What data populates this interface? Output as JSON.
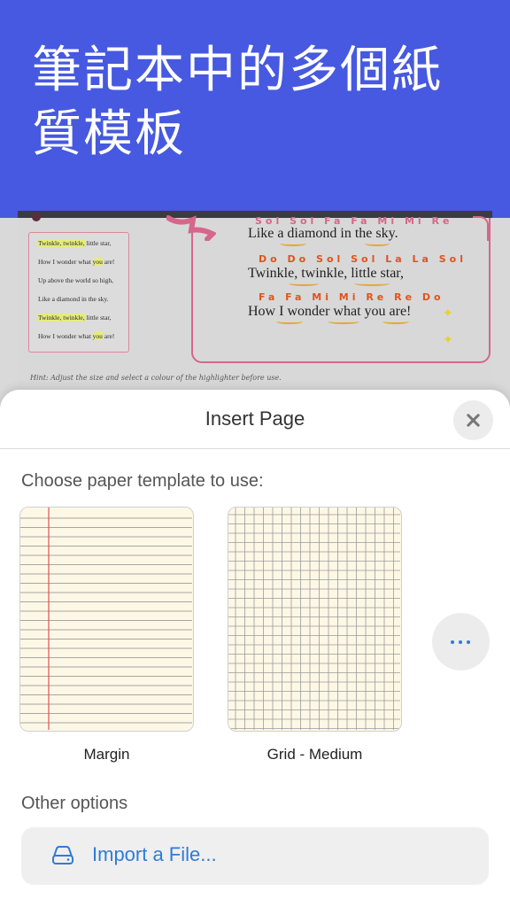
{
  "banner": {
    "title": "筆記本中的多個紙質模板"
  },
  "background_page": {
    "card_lines": [
      {
        "pre": "",
        "hl": "Twinkle, twinkle,",
        "post": " little star,"
      },
      {
        "pre": "How I wonder what ",
        "hl": "you",
        "post": " are!"
      },
      {
        "pre": "Up above the world so high,",
        "hl": "",
        "post": ""
      },
      {
        "pre": "Like a diamond in the sky.",
        "hl": "",
        "post": ""
      },
      {
        "pre": "",
        "hl": "Twinkle, twinkle,",
        "post": " little star,"
      },
      {
        "pre": "How I wonder what ",
        "hl": "you",
        "post": " are!"
      }
    ],
    "notes_top": "Sol Sol Fa Fa Mi Mi Re",
    "lyric_1": "Like a diamond in the sky.",
    "notes_2": "Do  Do  Sol Sol La La Sol",
    "lyric_2": "Twinkle, twinkle, little star,",
    "notes_3": "Fa Fa Mi Mi  Re  Re  Do",
    "lyric_3": "How I wonder what you are!",
    "hint": "Hint:  Adjust the size and select a colour of the highlighter before use."
  },
  "sheet": {
    "title": "Insert Page",
    "choose_label": "Choose paper template to use:",
    "templates": [
      {
        "label": "Margin"
      },
      {
        "label": "Grid - Medium"
      }
    ],
    "other_options_label": "Other options",
    "import_label": "Import a File..."
  },
  "colors": {
    "banner": "#4659e0",
    "accent": "#2f7bd9",
    "margin_line": "#e05050",
    "paper": "#fdf8e6"
  },
  "icons": {
    "close": "close-icon",
    "more": "more-horizontal-icon",
    "import": "drive-icon"
  }
}
